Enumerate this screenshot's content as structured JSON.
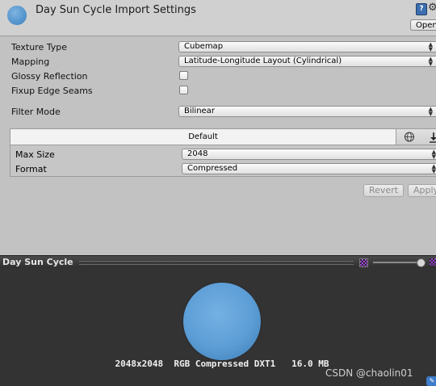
{
  "header": {
    "title": "Day Sun Cycle Import Settings",
    "help_icon": "?",
    "gear_icon": "⚙",
    "open_button": "Open"
  },
  "properties": {
    "texture_type": {
      "label": "Texture Type",
      "value": "Cubemap"
    },
    "mapping": {
      "label": "Mapping",
      "value": "Latitude-Longitude Layout (Cylindrical)"
    },
    "glossy_reflection": {
      "label": "Glossy Reflection",
      "checked": false
    },
    "fixup_edge_seams": {
      "label": "Fixup Edge Seams",
      "checked": false
    },
    "filter_mode": {
      "label": "Filter Mode",
      "value": "Bilinear"
    }
  },
  "platform": {
    "tab_default": "Default",
    "globe_icon": "globe-icon",
    "download_icon": "download-icon",
    "max_size": {
      "label": "Max Size",
      "value": "2048"
    },
    "format": {
      "label": "Format",
      "value": "Compressed"
    }
  },
  "buttons": {
    "revert": "Revert",
    "apply": "Apply"
  },
  "preview": {
    "title": "Day Sun Cycle",
    "info": "2048x2048  RGB Compressed DXT1   16.0 MB",
    "watermark": "CSDN @chaolin01",
    "sphere_color": "#5c9dd6"
  },
  "arrows": "▲\n▼"
}
